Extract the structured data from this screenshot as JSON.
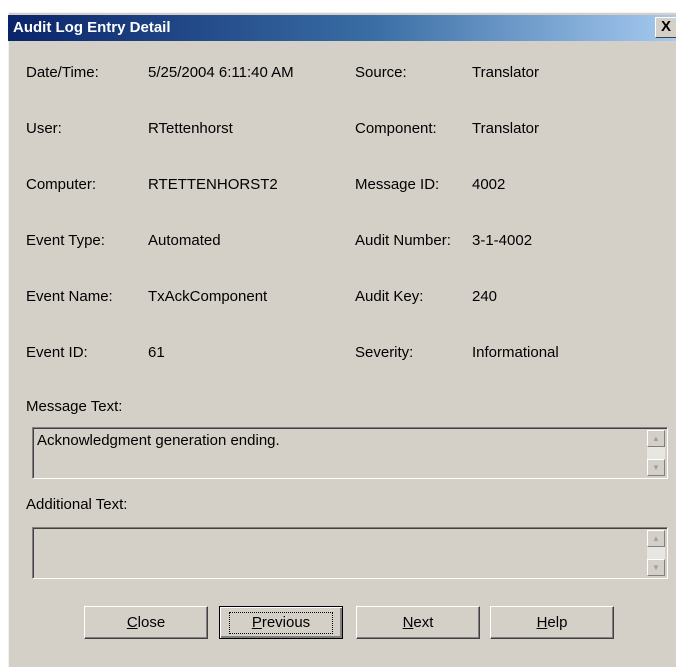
{
  "window": {
    "title": "Audit Log Entry Detail",
    "close_glyph": "X"
  },
  "fields": {
    "datetime_label": "Date/Time:",
    "datetime_value": "5/25/2004 6:11:40 AM",
    "source_label": "Source:",
    "source_value": "Translator",
    "user_label": "User:",
    "user_value": "RTettenhorst",
    "component_label": "Component:",
    "component_value": "Translator",
    "computer_label": "Computer:",
    "computer_value": "RTETTENHORST2",
    "message_id_label": "Message ID:",
    "message_id_value": "4002",
    "event_type_label": "Event Type:",
    "event_type_value": "Automated",
    "audit_number_label": "Audit Number:",
    "audit_number_value": "3-1-4002",
    "event_name_label": "Event Name:",
    "event_name_value": "TxAckComponent",
    "audit_key_label": "Audit Key:",
    "audit_key_value": "240",
    "event_id_label": "Event ID:",
    "event_id_value": "61",
    "severity_label": "Severity:",
    "severity_value": "Informational"
  },
  "message_text": {
    "label": "Message Text:",
    "value": "Acknowledgment generation ending."
  },
  "additional_text": {
    "label": "Additional Text:",
    "value": ""
  },
  "buttons": {
    "close_mnemonic": "C",
    "close_rest": "lose",
    "previous_mnemonic": "P",
    "previous_rest": "revious",
    "next_mnemonic": "N",
    "next_rest": "ext",
    "help_mnemonic": "H",
    "help_rest": "elp"
  },
  "icons": {
    "scroll_up": "up-arrow-icon",
    "scroll_down": "down-arrow-icon"
  }
}
